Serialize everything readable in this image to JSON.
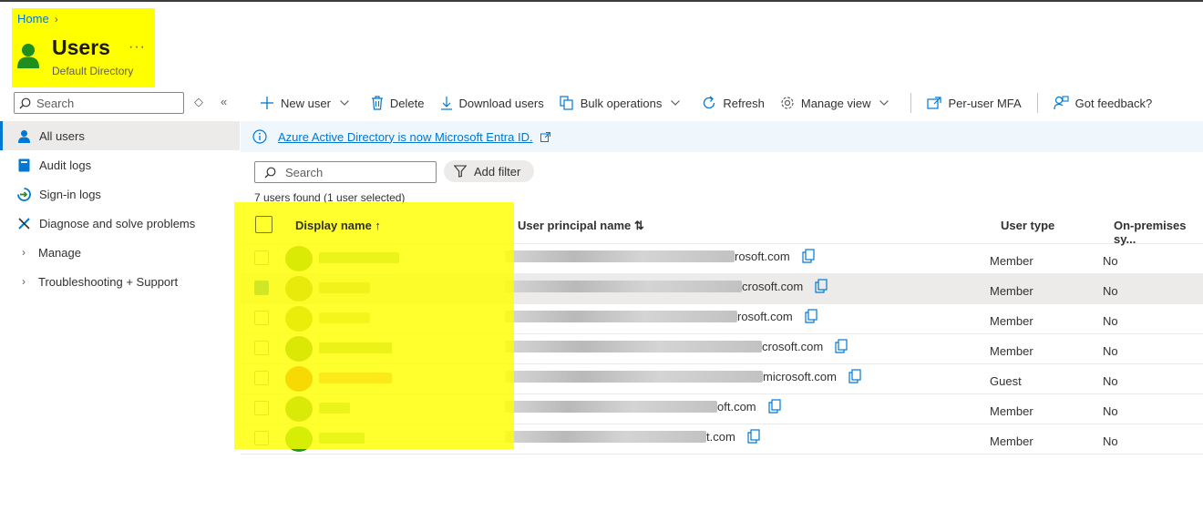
{
  "breadcrumb": {
    "home": "Home",
    "chevron": "›"
  },
  "header": {
    "title": "Users",
    "subtitle": "Default Directory",
    "more": "···"
  },
  "sidebar": {
    "search_placeholder": "Search",
    "items": [
      {
        "label": "All users",
        "icon": "user-icon",
        "active": true
      },
      {
        "label": "Audit logs",
        "icon": "book-icon"
      },
      {
        "label": "Sign-in logs",
        "icon": "sign-in-icon"
      },
      {
        "label": "Diagnose and solve problems",
        "icon": "wrench-icon"
      },
      {
        "label": "Manage",
        "icon": "chevron-right-icon"
      },
      {
        "label": "Troubleshooting + Support",
        "icon": "chevron-right-icon"
      }
    ]
  },
  "toolbar": {
    "new_user": "New user",
    "delete": "Delete",
    "download_users": "Download users",
    "bulk_operations": "Bulk operations",
    "refresh": "Refresh",
    "manage_view": "Manage view",
    "per_user_mfa": "Per-user MFA",
    "got_feedback": "Got feedback?"
  },
  "banner": {
    "text": "Azure Active Directory is now Microsoft Entra ID."
  },
  "filter": {
    "search_placeholder": "Search",
    "add_filter": "Add filter",
    "count_text": "7 users found (1 user selected)"
  },
  "table": {
    "columns": {
      "display_name": "Display name ↑",
      "upn": "User principal name ⇅",
      "user_type": "User type",
      "on_premises": "On-premises sy..."
    },
    "rows": [
      {
        "upn_visible": "rosoft.com",
        "user_type": "Member",
        "on_premises": "No",
        "selected": false,
        "avatar_color": "#3a8a1e"
      },
      {
        "upn_visible": "crosoft.com",
        "user_type": "Member",
        "on_premises": "No",
        "selected": true,
        "avatar_color": "#7a8a3a"
      },
      {
        "upn_visible": "rosoft.com",
        "user_type": "Member",
        "on_premises": "No",
        "selected": false,
        "avatar_color": "#8a9a3a"
      },
      {
        "upn_visible": "crosoft.com",
        "user_type": "Member",
        "on_premises": "No",
        "selected": false,
        "avatar_color": "#3a7a1e"
      },
      {
        "upn_visible": "microsoft.com",
        "user_type": "Guest",
        "on_premises": "No",
        "selected": false,
        "avatar_color": "#d4301a"
      },
      {
        "upn_visible": "oft.com",
        "user_type": "Member",
        "on_premises": "No",
        "selected": false,
        "avatar_color": "#2e8a2e"
      },
      {
        "upn_visible": "t.com",
        "user_type": "Member",
        "on_premises": "No",
        "selected": false,
        "avatar_color": "#1e9a1e"
      }
    ]
  }
}
